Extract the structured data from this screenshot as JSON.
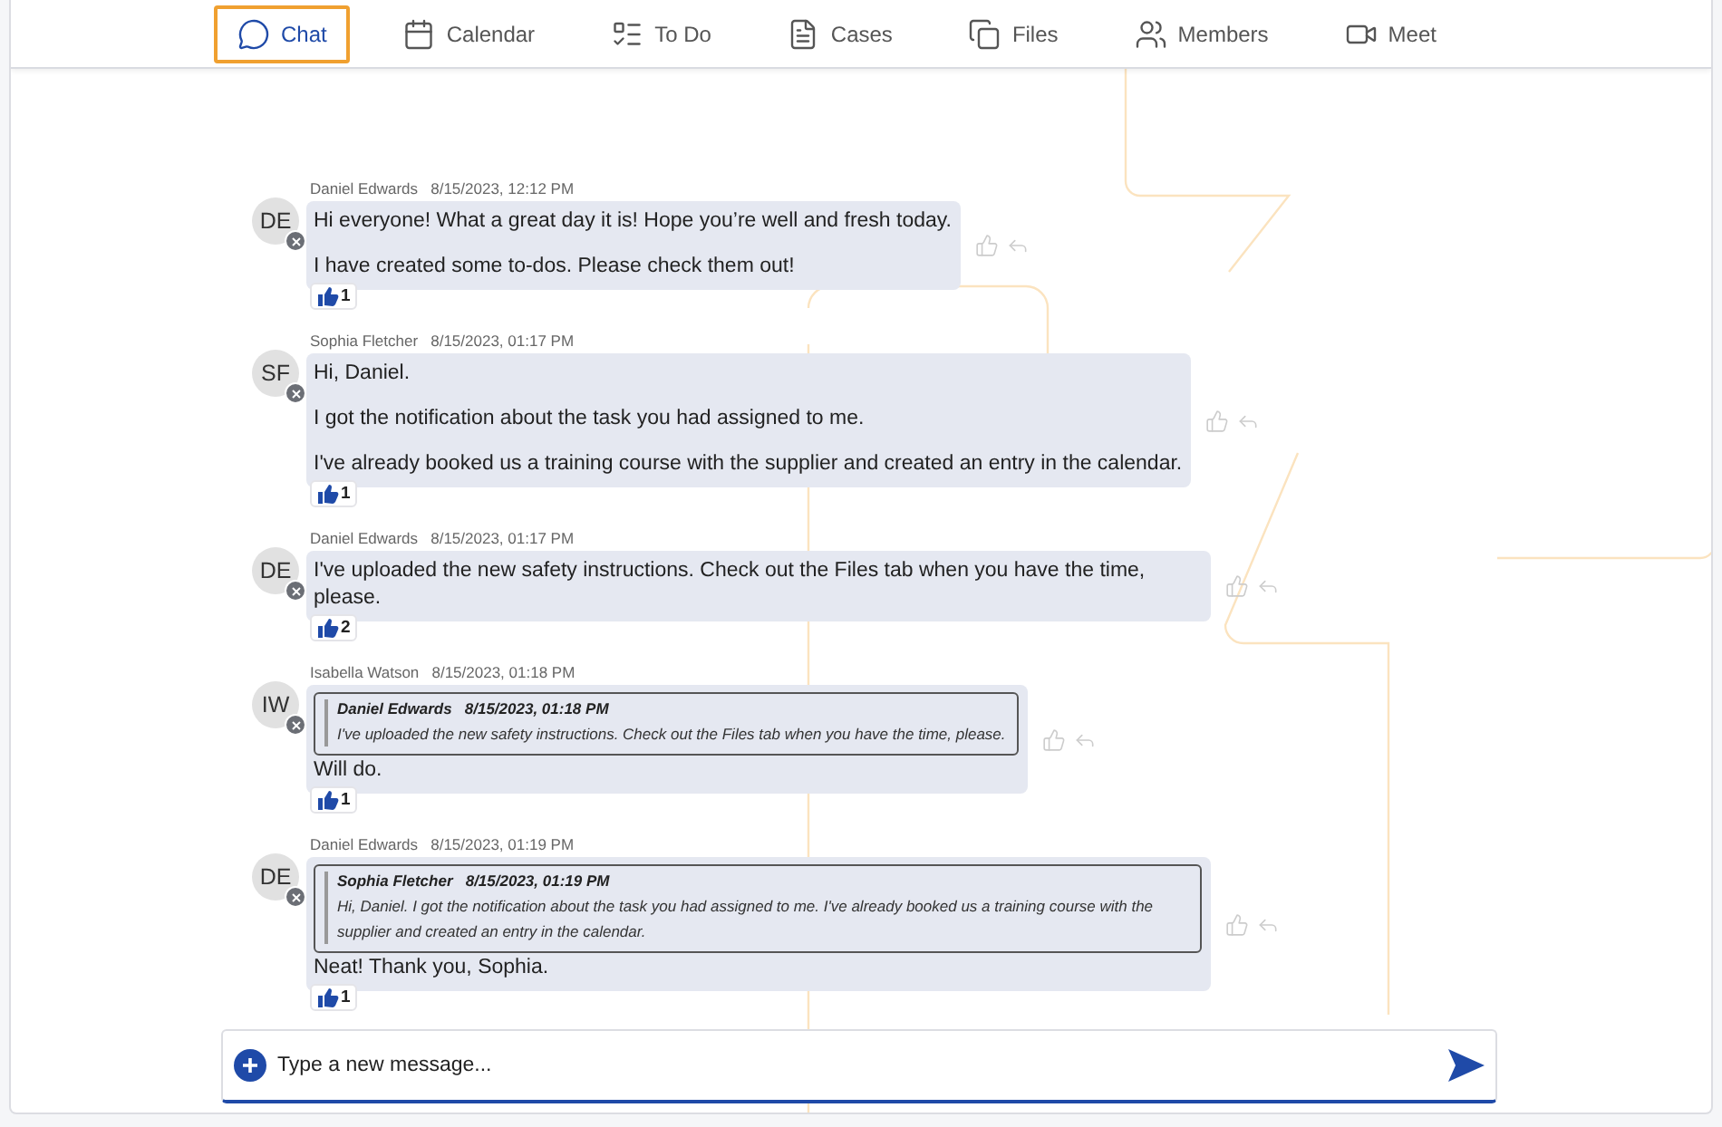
{
  "tabs": [
    {
      "label": "Chat",
      "selected": true
    },
    {
      "label": "Calendar",
      "selected": false
    },
    {
      "label": "To Do",
      "selected": false
    },
    {
      "label": "Cases",
      "selected": false
    },
    {
      "label": "Files",
      "selected": false
    },
    {
      "label": "Members",
      "selected": false
    },
    {
      "label": "Meet",
      "selected": false
    }
  ],
  "messages": [
    {
      "initials": "DE",
      "author": "Daniel Edwards",
      "time": "8/15/2023, 12:12 PM",
      "paragraphs": [
        "Hi everyone! What a great day it is! Hope you’re well and fresh today.",
        "I have created some to-dos. Please check them out!"
      ],
      "likes": "1"
    },
    {
      "initials": "SF",
      "author": "Sophia Fletcher",
      "time": "8/15/2023, 01:17 PM",
      "paragraphs": [
        "Hi, Daniel.",
        "I got the notification about the task you had assigned to me.",
        "I've already booked us a training course with the supplier and created an entry in the calendar."
      ],
      "likes": "1"
    },
    {
      "initials": "DE",
      "author": "Daniel Edwards",
      "time": "8/15/2023, 01:17 PM",
      "paragraphs": [
        "I've uploaded the new safety instructions. Check out the Files tab when you have the time, please."
      ],
      "likes": "2"
    },
    {
      "initials": "IW",
      "author": "Isabella Watson",
      "time": "8/15/2023, 01:18 PM",
      "quote": {
        "author": "Daniel Edwards",
        "time": "8/15/2023, 01:18 PM",
        "text": "I've uploaded the new safety instructions. Check out the Files tab when you have the time, please."
      },
      "paragraphs": [
        "Will do."
      ],
      "likes": "1"
    },
    {
      "initials": "DE",
      "author": "Daniel Edwards",
      "time": "8/15/2023, 01:19 PM",
      "quote": {
        "author": "Sophia Fletcher",
        "time": "8/15/2023, 01:19 PM",
        "text": "Hi, Daniel. I got the notification about the task you had assigned to me. I've already booked us a training course with the supplier and created an entry in the calendar."
      },
      "paragraphs": [
        "Neat! Thank you, Sophia."
      ],
      "likes": "1"
    }
  ],
  "composer": {
    "placeholder": "Type a new message..."
  }
}
